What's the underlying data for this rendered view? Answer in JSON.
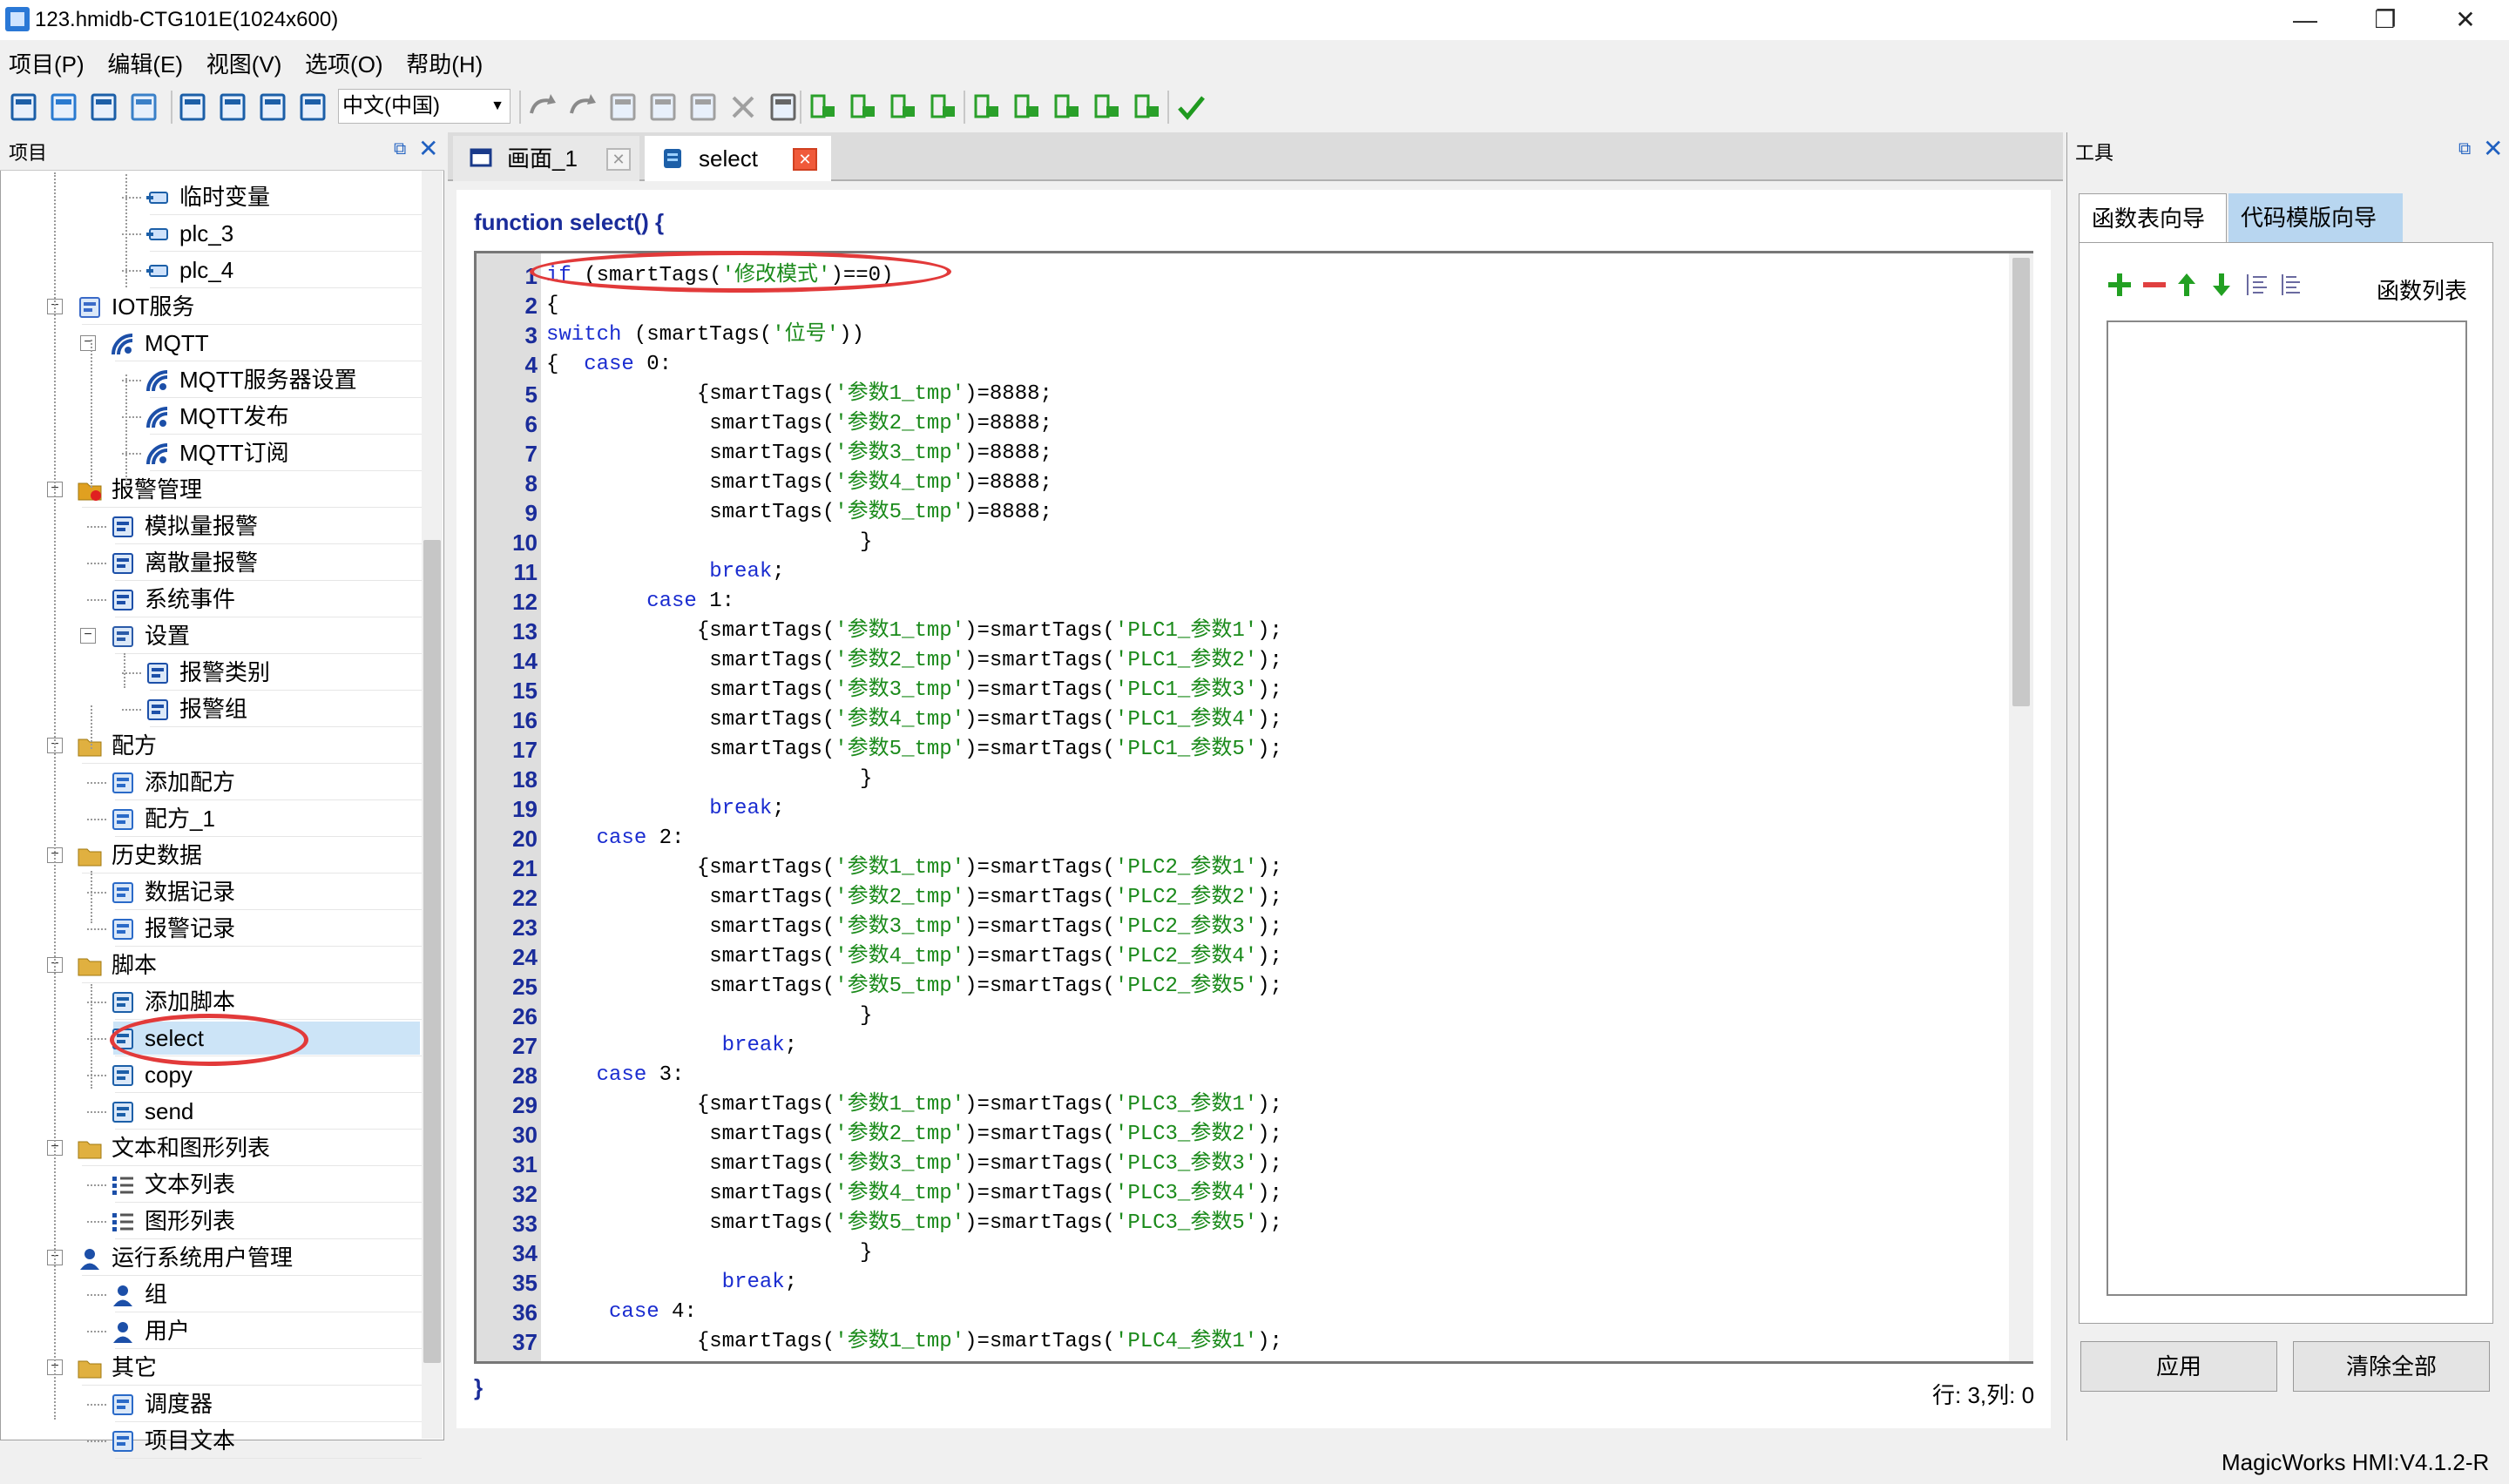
{
  "window": {
    "title": "123.hmidb-CTG101E(1024x600)",
    "controls": {
      "minimize": "—",
      "restore": "❐",
      "close": "✕"
    }
  },
  "menu": [
    "项目(P)",
    "编辑(E)",
    "视图(V)",
    "选项(O)",
    "帮助(H)"
  ],
  "toolbar": {
    "language": "中文(中国)",
    "icons": [
      "new-icon",
      "open-icon",
      "save-icon",
      "save-as-icon",
      "grid-icon",
      "download-icon",
      "upload-icon",
      "transfer-icon",
      "undo-icon",
      "redo-icon",
      "cut-icon",
      "copy-icon",
      "paste-icon",
      "delete-icon",
      "find-icon",
      "insert-icon",
      "function-icon",
      "sv-icon",
      "sf-icon",
      "indent-icon",
      "outdent-icon",
      "comment-icon",
      "uncomment-icon",
      "move-down-icon",
      "check-icon"
    ]
  },
  "project_panel": {
    "title": "项目",
    "tree": [
      {
        "label": "临时变量",
        "level": 3,
        "icon": "tag-icon"
      },
      {
        "label": "plc_3",
        "level": 3,
        "icon": "tag-icon"
      },
      {
        "label": "plc_4",
        "level": 3,
        "icon": "tag-icon"
      },
      {
        "label": "IOT服务",
        "level": 1,
        "icon": "iot-icon",
        "expander": "−"
      },
      {
        "label": "MQTT",
        "level": 2,
        "icon": "signal-icon",
        "expander": "−"
      },
      {
        "label": "MQTT服务器设置",
        "level": 3,
        "icon": "signal-icon"
      },
      {
        "label": "MQTT发布",
        "level": 3,
        "icon": "signal-icon"
      },
      {
        "label": "MQTT订阅",
        "level": 3,
        "icon": "signal-icon"
      },
      {
        "label": "报警管理",
        "level": 1,
        "icon": "alarm-folder-icon",
        "expander": "−"
      },
      {
        "label": "模拟量报警",
        "level": 2,
        "icon": "alarm-icon"
      },
      {
        "label": "离散量报警",
        "level": 2,
        "icon": "alarm-icon"
      },
      {
        "label": "系统事件",
        "level": 2,
        "icon": "alarm-icon"
      },
      {
        "label": "设置",
        "level": 2,
        "icon": "settings-icon",
        "expander": "−"
      },
      {
        "label": "报警类别",
        "level": 3,
        "icon": "alarm-category-icon"
      },
      {
        "label": "报警组",
        "level": 3,
        "icon": "alarm-category-icon"
      },
      {
        "label": "配方",
        "level": 1,
        "icon": "folder-icon",
        "expander": "−"
      },
      {
        "label": "添加配方",
        "level": 2,
        "icon": "add-doc-icon"
      },
      {
        "label": "配方_1",
        "level": 2,
        "icon": "doc-icon"
      },
      {
        "label": "历史数据",
        "level": 1,
        "icon": "folder-icon",
        "expander": "−"
      },
      {
        "label": "数据记录",
        "level": 2,
        "icon": "chart-doc-icon"
      },
      {
        "label": "报警记录",
        "level": 2,
        "icon": "doc-icon"
      },
      {
        "label": "脚本",
        "level": 1,
        "icon": "folder-icon",
        "expander": "−"
      },
      {
        "label": "添加脚本",
        "level": 2,
        "icon": "script-add-icon"
      },
      {
        "label": "select",
        "level": 2,
        "icon": "script-icon",
        "selected": true
      },
      {
        "label": "copy",
        "level": 2,
        "icon": "script-icon"
      },
      {
        "label": "send",
        "level": 2,
        "icon": "script-icon"
      },
      {
        "label": "文本和图形列表",
        "level": 1,
        "icon": "folder-icon",
        "expander": "−"
      },
      {
        "label": "文本列表",
        "level": 2,
        "icon": "list-icon"
      },
      {
        "label": "图形列表",
        "level": 2,
        "icon": "list-icon"
      },
      {
        "label": "运行系统用户管理",
        "level": 1,
        "icon": "users-icon",
        "expander": "−"
      },
      {
        "label": "组",
        "level": 2,
        "icon": "group-icon"
      },
      {
        "label": "用户",
        "level": 2,
        "icon": "user-icon"
      },
      {
        "label": "其它",
        "level": 1,
        "icon": "folder-icon",
        "expander": "−"
      },
      {
        "label": "调度器",
        "level": 2,
        "icon": "scheduler-icon"
      },
      {
        "label": "项目文本",
        "level": 2,
        "icon": "doc-icon"
      }
    ]
  },
  "tabs": [
    {
      "label": "画面_1",
      "icon": "screen-icon",
      "active": false
    },
    {
      "label": "select",
      "icon": "script-icon",
      "active": true
    }
  ],
  "editor": {
    "header": "function select() {",
    "footer": "}",
    "status": "行: 3,列: 0",
    "lines": [
      {
        "n": "1",
        "code": "if (smartTags('修改模式')==0)"
      },
      {
        "n": "2",
        "code": "{"
      },
      {
        "n": "3",
        "code": "switch (smartTags('位号'))"
      },
      {
        "n": "4",
        "code": "{  case 0:"
      },
      {
        "n": "5",
        "code": "            {smartTags('参数1_tmp')=8888;"
      },
      {
        "n": "6",
        "code": "             smartTags('参数2_tmp')=8888;"
      },
      {
        "n": "7",
        "code": "             smartTags('参数3_tmp')=8888;"
      },
      {
        "n": "8",
        "code": "             smartTags('参数4_tmp')=8888;"
      },
      {
        "n": "9",
        "code": "             smartTags('参数5_tmp')=8888;"
      },
      {
        "n": "10",
        "code": "                         }"
      },
      {
        "n": "11",
        "code": "             break;"
      },
      {
        "n": "12",
        "code": "        case 1:"
      },
      {
        "n": "13",
        "code": "            {smartTags('参数1_tmp')=smartTags('PLC1_参数1');"
      },
      {
        "n": "14",
        "code": "             smartTags('参数2_tmp')=smartTags('PLC1_参数2');"
      },
      {
        "n": "15",
        "code": "             smartTags('参数3_tmp')=smartTags('PLC1_参数3');"
      },
      {
        "n": "16",
        "code": "             smartTags('参数4_tmp')=smartTags('PLC1_参数4');"
      },
      {
        "n": "17",
        "code": "             smartTags('参数5_tmp')=smartTags('PLC1_参数5');"
      },
      {
        "n": "18",
        "code": "                         }"
      },
      {
        "n": "19",
        "code": "             break;"
      },
      {
        "n": "20",
        "code": "    case 2:"
      },
      {
        "n": "21",
        "code": "            {smartTags('参数1_tmp')=smartTags('PLC2_参数1');"
      },
      {
        "n": "22",
        "code": "             smartTags('参数2_tmp')=smartTags('PLC2_参数2');"
      },
      {
        "n": "23",
        "code": "             smartTags('参数3_tmp')=smartTags('PLC2_参数3');"
      },
      {
        "n": "24",
        "code": "             smartTags('参数4_tmp')=smartTags('PLC2_参数4');"
      },
      {
        "n": "25",
        "code": "             smartTags('参数5_tmp')=smartTags('PLC2_参数5');"
      },
      {
        "n": "26",
        "code": "                         }"
      },
      {
        "n": "27",
        "code": "              break;"
      },
      {
        "n": "28",
        "code": "    case 3:"
      },
      {
        "n": "29",
        "code": "            {smartTags('参数1_tmp')=smartTags('PLC3_参数1');"
      },
      {
        "n": "30",
        "code": "             smartTags('参数2_tmp')=smartTags('PLC3_参数2');"
      },
      {
        "n": "31",
        "code": "             smartTags('参数3_tmp')=smartTags('PLC3_参数3');"
      },
      {
        "n": "32",
        "code": "             smartTags('参数4_tmp')=smartTags('PLC3_参数4');"
      },
      {
        "n": "33",
        "code": "             smartTags('参数5_tmp')=smartTags('PLC3_参数5');"
      },
      {
        "n": "34",
        "code": "                         }"
      },
      {
        "n": "35",
        "code": "              break;"
      },
      {
        "n": "36",
        "code": "     case 4:"
      },
      {
        "n": "37",
        "code": "            {smartTags('参数1_tmp')=smartTags('PLC4_参数1');"
      }
    ]
  },
  "tools_panel": {
    "title": "工具",
    "tabs": [
      "函数表向导",
      "代码模版向导"
    ],
    "list_label": "函数列表",
    "icons": [
      "add-icon",
      "remove-icon",
      "move-up-icon",
      "move-down-icon",
      "indent-list-icon",
      "outdent-list-icon"
    ],
    "apply_button": "应用",
    "clear_button": "清除全部"
  },
  "statusbar": {
    "version": "MagicWorks HMI:V4.1.2-R"
  },
  "colors": {
    "accent": "#1a2c9a",
    "keyword": "#1a2cd0",
    "string": "#1a8a1a",
    "annotation": "#e23a3a",
    "selection": "#cce4f7"
  }
}
